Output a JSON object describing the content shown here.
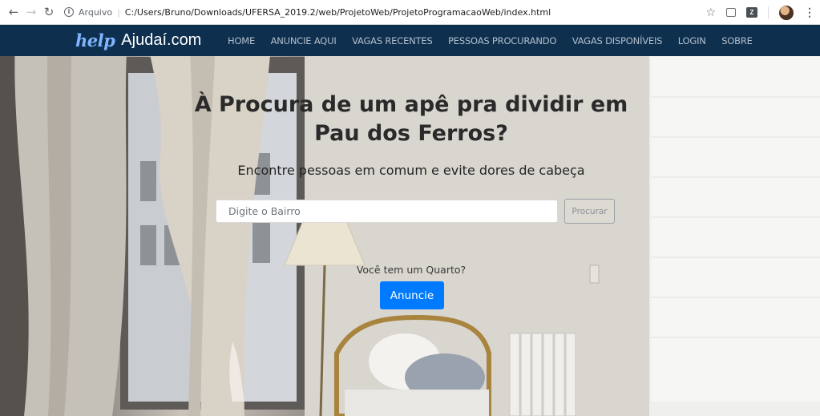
{
  "browser": {
    "scheme_label": "Arquivo",
    "url": "C:/Users/Bruno/Downloads/UFERSA_2019.2/web/ProjetoWeb/ProjetoProgramacaoWeb/index.html",
    "icons": [
      "back-arrow-icon",
      "forward-arrow-icon",
      "reload-icon",
      "info-icon",
      "star-icon",
      "extension-icon",
      "avatar",
      "menu-kebab-icon"
    ]
  },
  "navbar": {
    "logo_text": "help",
    "brand_name": "Ajudaí.com",
    "items": [
      {
        "label": "HOME"
      },
      {
        "label": "ANUNCIE AQUI"
      },
      {
        "label": "VAGAS RECENTES"
      },
      {
        "label": "PESSOAS PROCURANDO"
      },
      {
        "label": "VAGAS DISPONÍVEIS"
      },
      {
        "label": "LOGIN"
      },
      {
        "label": "SOBRE"
      }
    ],
    "colors": {
      "background": "#0e2f4e",
      "link": "#b3bfcc",
      "logo": "#7fb4ff"
    }
  },
  "hero": {
    "headline": "À Procura de um apê pra dividir em Pau dos Ferros?",
    "subheadline": "Encontre pessoas em comum e evite dores de cabeça",
    "search": {
      "placeholder": "Digite o Bairro",
      "button_label": "Procurar"
    },
    "cta": {
      "question": "Você tem um Quarto?",
      "button_label": "Anuncie",
      "button_color": "#007bff"
    }
  }
}
